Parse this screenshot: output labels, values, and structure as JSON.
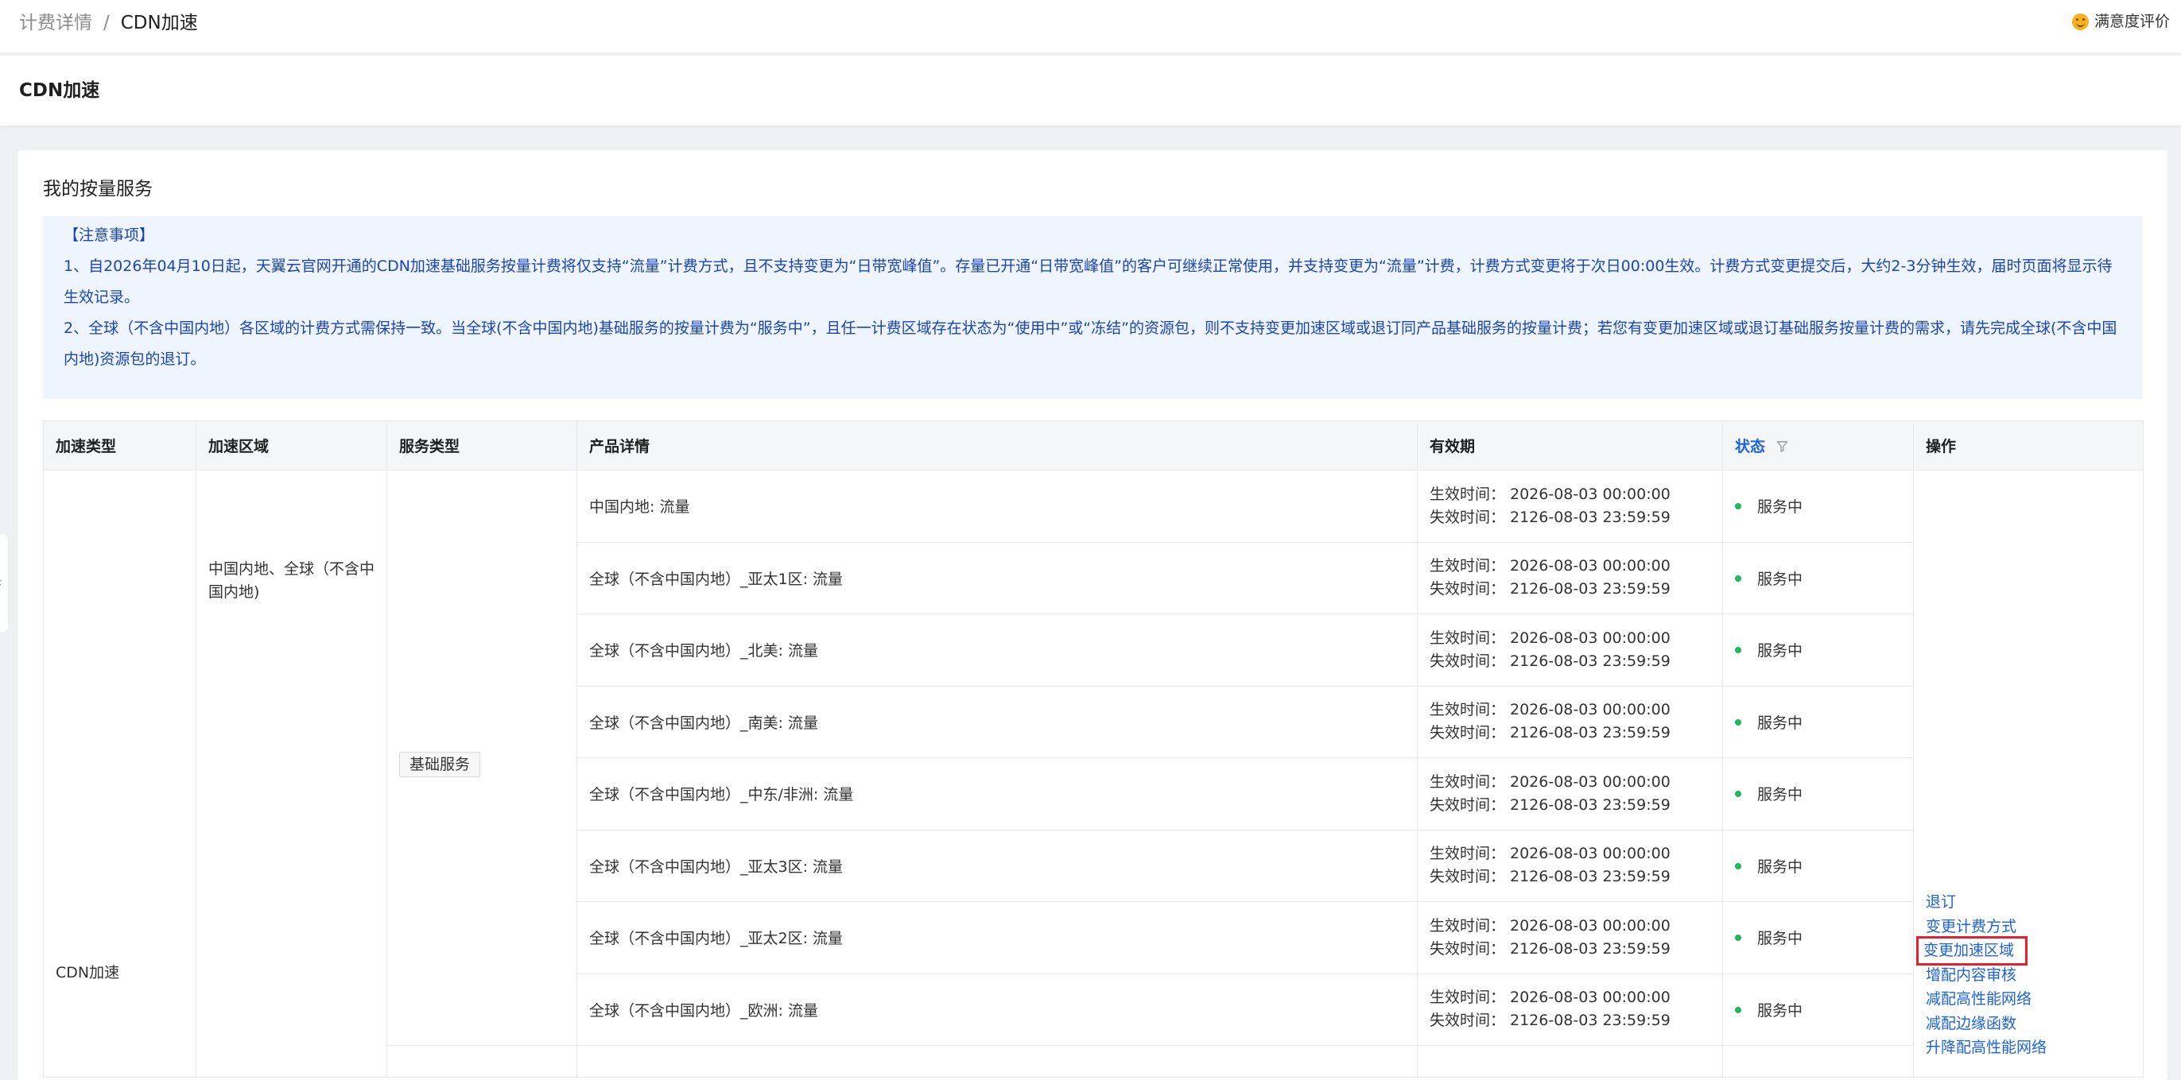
{
  "breadcrumb": {
    "parent": "计费详情",
    "separator": "/",
    "current": "CDN加速"
  },
  "feedback": {
    "label": "满意度评价"
  },
  "page_title": "CDN加速",
  "section_title": "我的按量服务",
  "notice": {
    "heading": "【注意事项】",
    "line1": "1、自2026年04月10日起，天翼云官网开通的CDN加速基础服务按量计费将仅支持“流量”计费方式，且不支持变更为“日带宽峰值”。存量已开通“日带宽峰值”的客户可继续正常使用，并支持变更为“流量”计费，计费方式变更将于次日00:00生效。计费方式变更提交后，大约2-3分钟生效，届时页面将显示待生效记录。",
    "line2": "2、全球（不含中国内地）各区域的计费方式需保持一致。当全球(不含中国内地)基础服务的按量计费为“服务中”，且任一计费区域存在状态为“使用中”或“冻结”的资源包，则不支持变更加速区域或退订同产品基础服务的按量计费；若您有变更加速区域或退订基础服务按量计费的需求，请先完成全球(不含中国内地)资源包的退订。"
  },
  "table": {
    "headers": {
      "accel_type": "加速类型",
      "accel_region": "加速区域",
      "service_type": "服务类型",
      "product_detail": "产品详情",
      "validity": "有效期",
      "status": "状态",
      "actions": "操作"
    },
    "accel_type": "CDN加速",
    "accel_region": "中国内地、全球（不含中国内地)",
    "service_type": "基础服务",
    "start_label": "生效时间：",
    "end_label": "失效时间：",
    "rows": [
      {
        "product": "中国内地: 流量",
        "start": "2026-08-03 00:00:00",
        "end": "2126-08-03 23:59:59",
        "status": "服务中"
      },
      {
        "product": "全球（不含中国内地）_亚太1区: 流量",
        "start": "2026-08-03 00:00:00",
        "end": "2126-08-03 23:59:59",
        "status": "服务中"
      },
      {
        "product": "全球（不含中国内地）_北美: 流量",
        "start": "2026-08-03 00:00:00",
        "end": "2126-08-03 23:59:59",
        "status": "服务中"
      },
      {
        "product": "全球（不含中国内地）_南美: 流量",
        "start": "2026-08-03 00:00:00",
        "end": "2126-08-03 23:59:59",
        "status": "服务中"
      },
      {
        "product": "全球（不含中国内地）_中东/非洲: 流量",
        "start": "2026-08-03 00:00:00",
        "end": "2126-08-03 23:59:59",
        "status": "服务中"
      },
      {
        "product": "全球（不含中国内地）_亚太3区: 流量",
        "start": "2026-08-03 00:00:00",
        "end": "2126-08-03 23:59:59",
        "status": "服务中"
      },
      {
        "product": "全球（不含中国内地）_亚太2区: 流量",
        "start": "2026-08-03 00:00:00",
        "end": "2126-08-03 23:59:59",
        "status": "服务中"
      },
      {
        "product": "全球（不含中国内地）_欧洲: 流量",
        "start": "2026-08-03 00:00:00",
        "end": "2126-08-03 23:59:59",
        "status": "服务中"
      }
    ],
    "actions": [
      "退订",
      "变更计费方式",
      "变更加速区域",
      "增配内容审核",
      "减配高性能网络",
      "减配边缘函数",
      "升降配高性能网络"
    ]
  },
  "colors": {
    "link": "#1d62e0",
    "notice_bg": "#eef5fe",
    "notice_text": "#1b44b8",
    "status_dot": "#1fb85c",
    "highlight_box": "#e8202c"
  },
  "icons": {
    "feedback": "smile-icon",
    "status_filter": "filter-icon",
    "collapse": "chevron-left-icon"
  }
}
